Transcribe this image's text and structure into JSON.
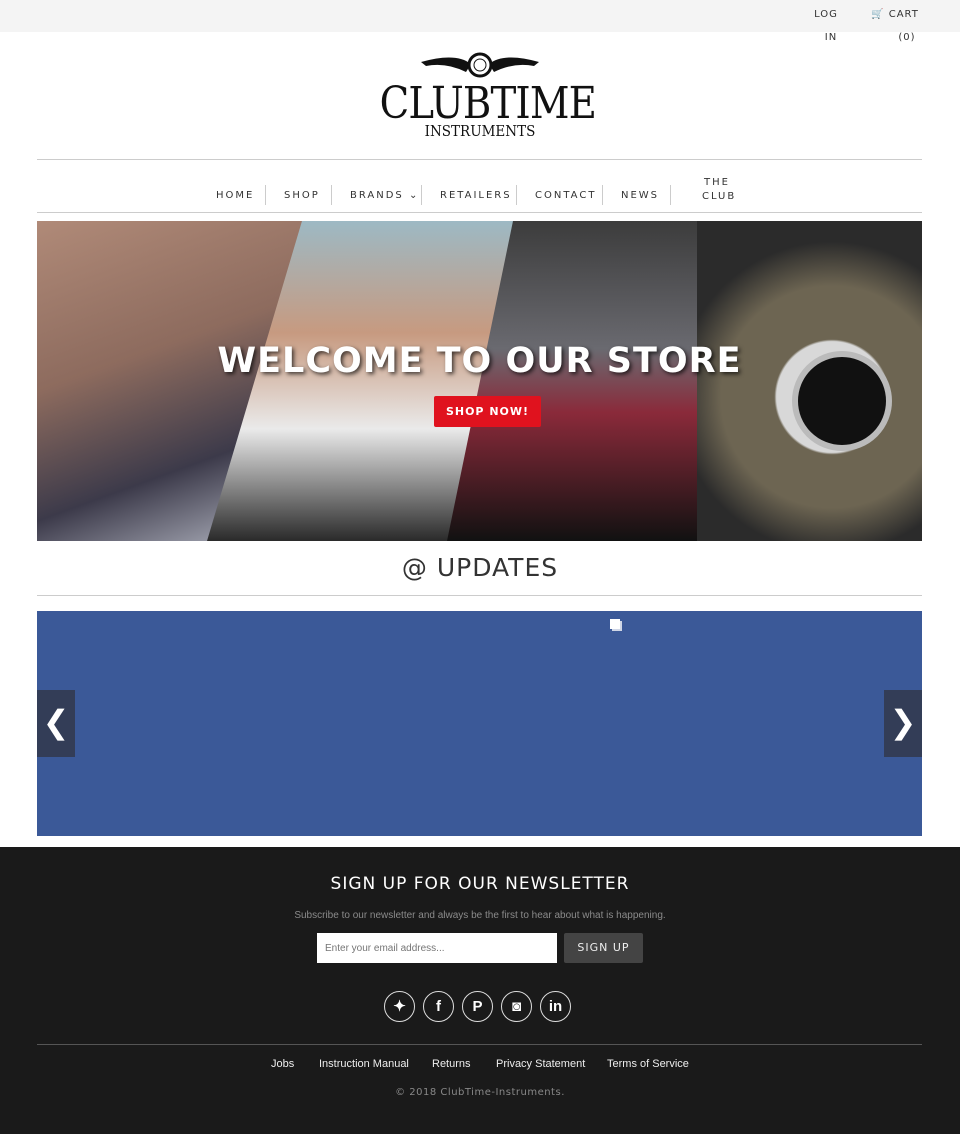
{
  "topbar": {
    "login_line1": "LOG",
    "login_line2": "IN",
    "cart_label": "CART",
    "cart_count": "(0)"
  },
  "logo": {
    "title": "CLUBTIME",
    "subtitle": "INSTRUMENTS"
  },
  "nav": [
    {
      "label": "HOME"
    },
    {
      "label": "SHOP"
    },
    {
      "label": "BRANDS ⌄"
    },
    {
      "label": "RETAILERS"
    },
    {
      "label": "CONTACT"
    },
    {
      "label": "NEWS"
    },
    {
      "label": "THE"
    },
    {
      "label": "CLUB"
    }
  ],
  "hero": {
    "title": "WELCOME TO OUR STORE",
    "button": "SHOP NOW!"
  },
  "updates": {
    "title": "@ UPDATES",
    "feed_color": "#3b5998",
    "prev": "❮",
    "next": "❯"
  },
  "footer": {
    "title": "SIGN UP FOR OUR NEWSLETTER",
    "subtitle": "Subscribe to our newsletter and always be the first to hear about what is happening.",
    "email_placeholder": "Enter your email address...",
    "signup": "SIGN UP",
    "social": [
      {
        "icon": "twitter-icon",
        "glyph": "🐦"
      },
      {
        "icon": "facebook-icon",
        "glyph": "f"
      },
      {
        "icon": "pinterest-icon",
        "glyph": "P"
      },
      {
        "icon": "instagram-icon",
        "glyph": "◙"
      },
      {
        "icon": "linkedin-icon",
        "glyph": "in"
      }
    ],
    "links": [
      "Jobs",
      "Instruction Manual",
      "Returns",
      "Privacy Statement",
      "Terms of Service"
    ],
    "copyright": "© 2018 ClubTime-Instruments."
  },
  "colors": {
    "accent": "#e0121e",
    "footer_bg": "#1a1a1a"
  }
}
